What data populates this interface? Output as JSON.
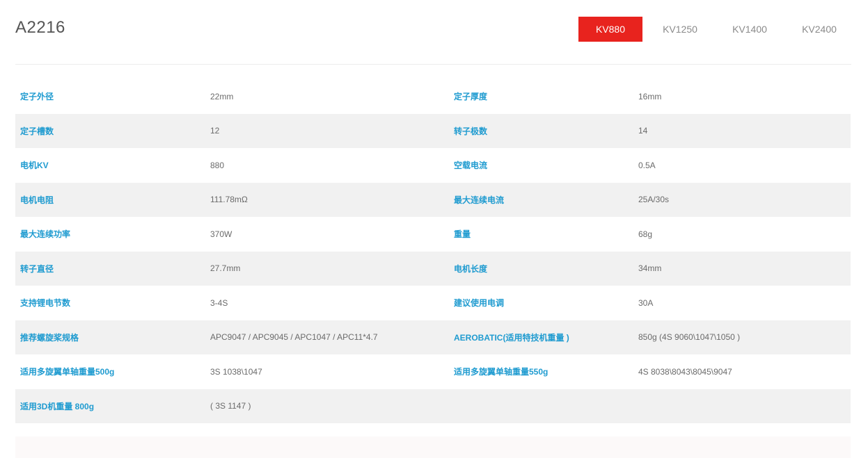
{
  "header": {
    "title": "A2216",
    "tabs": [
      {
        "label": "KV880",
        "active": true
      },
      {
        "label": "KV1250",
        "active": false
      },
      {
        "label": "KV1400",
        "active": false
      },
      {
        "label": "KV2400",
        "active": false
      }
    ]
  },
  "colors": {
    "accent": "#e8231e",
    "label": "#1f9bd0",
    "value": "#6a6a6a",
    "row_alt": "#f1f1f1"
  },
  "specs": [
    {
      "l1": "定子外径",
      "v1": "22mm",
      "l2": "定子厚度",
      "v2": "16mm"
    },
    {
      "l1": "定子槽数",
      "v1": "12",
      "l2": "转子极数",
      "v2": "14"
    },
    {
      "l1": "电机KV",
      "v1": "880",
      "l2": "空载电流",
      "v2": "0.5A"
    },
    {
      "l1": "电机电阻",
      "v1": "111.78mΩ",
      "l2": "最大连续电流",
      "v2": "25A/30s"
    },
    {
      "l1": "最大连续功率",
      "v1": "370W",
      "l2": "重量",
      "v2": "68g"
    },
    {
      "l1": "转子直径",
      "v1": "27.7mm",
      "l2": "电机长度",
      "v2": "34mm"
    },
    {
      "l1": "支持锂电节数",
      "v1": "3-4S",
      "l2": "建议使用电调",
      "v2": "30A"
    },
    {
      "l1": "推荐螺旋桨规格",
      "v1": "APC9047 / APC9045 / APC1047 / APC11*4.7",
      "l2": "AEROBATIC(适用特技机重量 )",
      "v2": "850g (4S 9060\\1047\\1050 )"
    },
    {
      "l1": "适用多旋翼单轴重量500g",
      "v1": "3S 1038\\1047",
      "l2": "适用多旋翼单轴重量550g",
      "v2": "4S 8038\\8043\\8045\\9047"
    },
    {
      "l1": "适用3D机重量 800g",
      "v1": "( 3S 1147 )",
      "l2": "",
      "v2": ""
    }
  ]
}
